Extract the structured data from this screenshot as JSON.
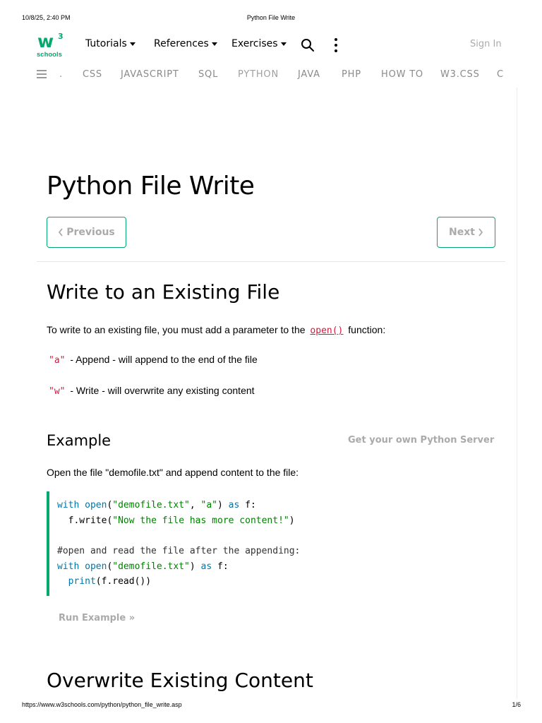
{
  "print_header": {
    "datetime": "10/8/25, 2:40 PM",
    "title": "Python File Write"
  },
  "print_footer": {
    "url": "https://www.w3schools.com/python/python_file_write.asp",
    "page": "1/6"
  },
  "logo": {
    "main": "w",
    "sup": "3",
    "sub": "schools"
  },
  "topnav": {
    "tutorials": "Tutorials",
    "references": "References",
    "exercises": "Exercises",
    "sign_in": "Sign In"
  },
  "subnav": {
    "items": [
      ".",
      "CSS",
      "JAVASCRIPT",
      "SQL",
      "PYTHON",
      "JAVA",
      "PHP",
      "HOW TO",
      "W3.CSS",
      "C"
    ]
  },
  "page": {
    "title": "Python File Write",
    "prev_label": "Previous",
    "next_label": "Next",
    "section1_heading": "Write to an Existing File",
    "intro_before": "To write to an existing file, you must add a parameter to the ",
    "intro_code": "open()",
    "intro_after": " function:",
    "mode_a_code": "\"a\"",
    "mode_a_text": " - Append - will append to the end of the file",
    "mode_w_code": "\"w\"",
    "mode_w_text": " - Write - will overwrite any existing content",
    "example_heading": "Example",
    "server_link": "Get your own Python Server",
    "example_desc": "Open the file \"demofile.txt\" and append content to the file:",
    "run_example": "Run Example »",
    "section2_heading": "Overwrite Existing Content"
  },
  "code": {
    "l1_kw1": "with",
    "l1_fn": "open",
    "l1_p1": "(",
    "l1_s1": "\"demofile.txt\"",
    "l1_c": ", ",
    "l1_s2": "\"a\"",
    "l1_p2": ") ",
    "l1_kw2": "as",
    "l1_end": " f:",
    "l2_pre": "  f.write(",
    "l2_s": "\"Now the file has more content!\"",
    "l2_end": ")",
    "l4_cmt": "#open and read the file after the appending:",
    "l5_kw1": "with",
    "l5_fn": "open",
    "l5_p1": "(",
    "l5_s": "\"demofile.txt\"",
    "l5_p2": ") ",
    "l5_kw2": "as",
    "l5_end": " f:",
    "l6_indent": "  ",
    "l6_fn": "print",
    "l6_end": "(f.read())"
  },
  "colors": {
    "brand_green": "#04AA6D",
    "code_keyword": "#0077aa",
    "code_string": "#008000",
    "inline_code": "#dc143c"
  },
  "icons": {
    "search": "search-icon",
    "more": "kebab-icon",
    "menu": "hamburger-icon",
    "caret": "caret-down-icon",
    "prev": "chevron-left-icon",
    "next": "chevron-right-icon"
  }
}
